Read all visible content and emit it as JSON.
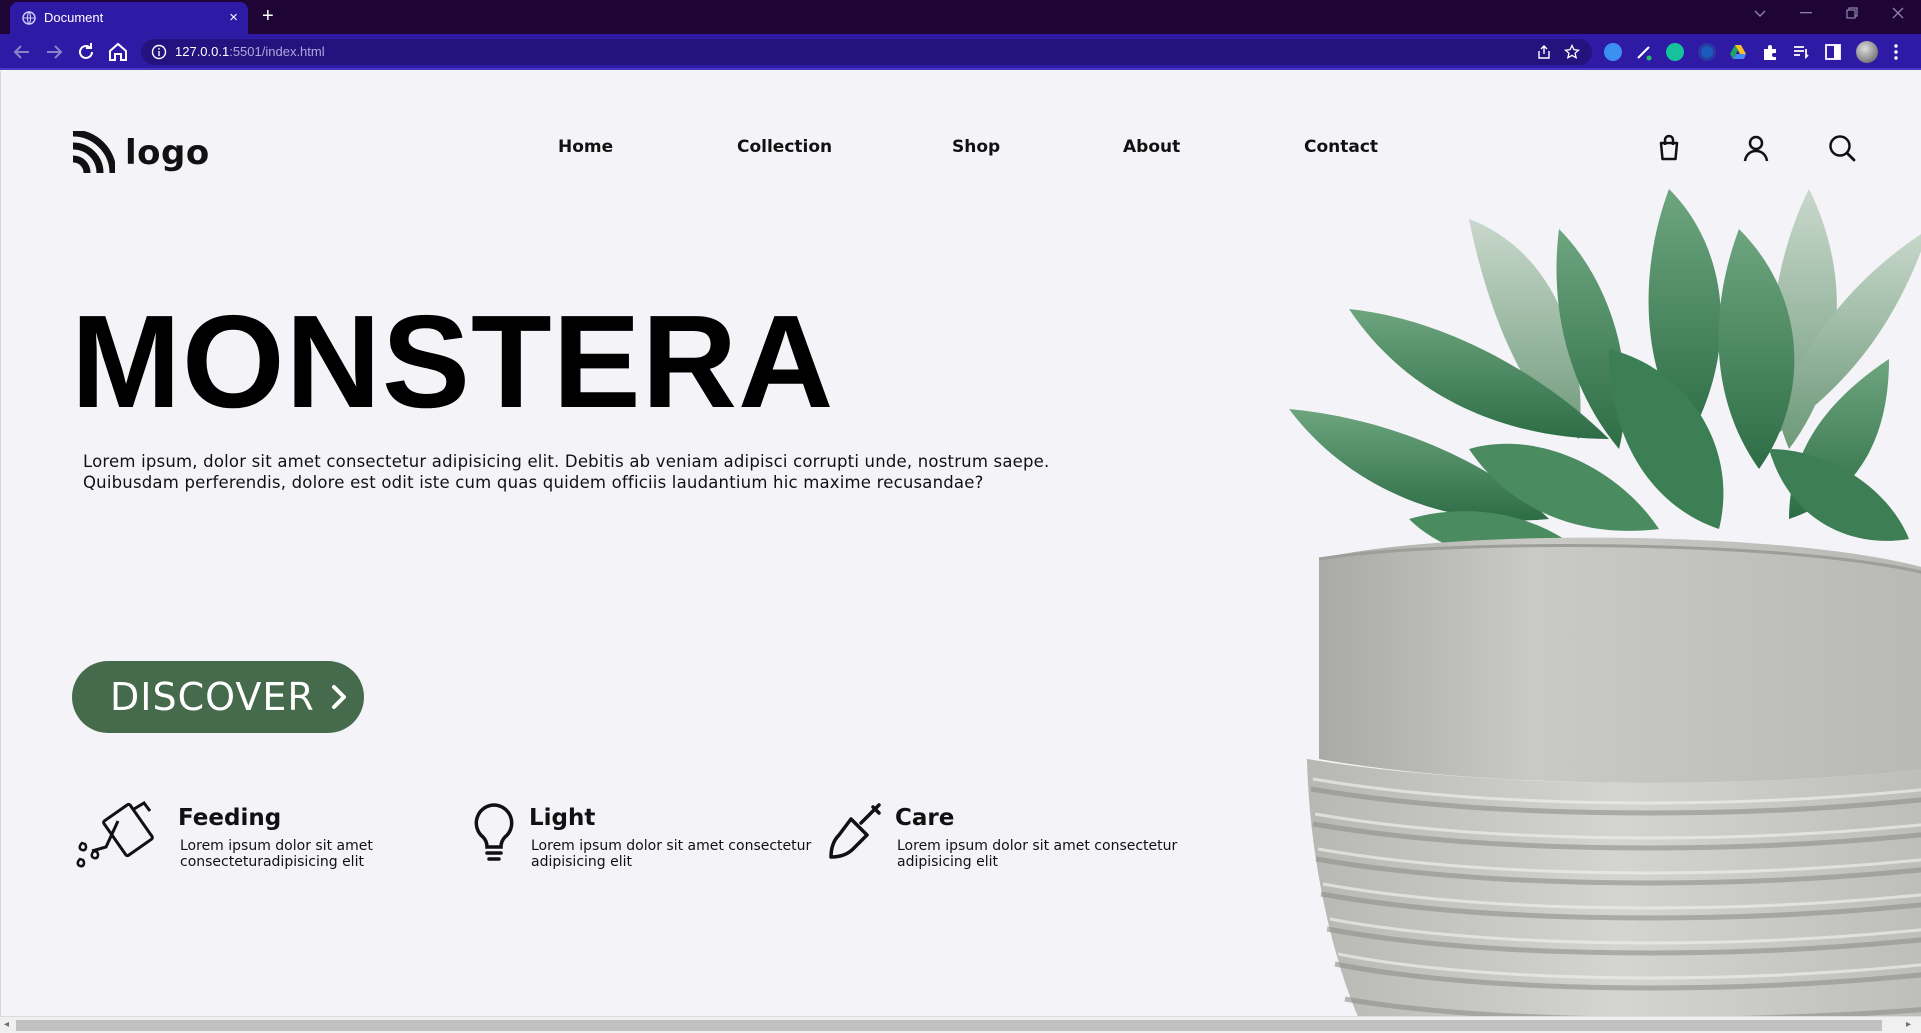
{
  "browser": {
    "tab_title": "Document",
    "tab_close": "×",
    "new_tab": "+",
    "url_host": "127.0.0.1",
    "url_rest": ":5501/index.html"
  },
  "header": {
    "logo_text": "logo",
    "nav": [
      "Home",
      "Collection",
      "Shop",
      "About",
      "Contact"
    ]
  },
  "hero": {
    "title": "MONSTERA",
    "description_line1": "Lorem ipsum, dolor sit amet consectetur adipisicing elit. Debitis ab veniam adipisci corrupti unde, nostrum saepe.",
    "description_line2": "Quibusdam perferendis, dolore est odit iste cum quas quidem officiis laudantium hic maxime recusandae?",
    "button_label": "DISCOVER"
  },
  "features": [
    {
      "icon": "watering-can-icon",
      "title": "Feeding",
      "line1": "Lorem ipsum dolor sit amet",
      "line2": "consecteturadipisicing elit"
    },
    {
      "icon": "lightbulb-icon",
      "title": "Light",
      "line1": "Lorem ipsum dolor sit amet consectetur",
      "line2": "adipisicing elit"
    },
    {
      "icon": "shovel-icon",
      "title": "Care",
      "line1": "Lorem ipsum dolor sit amet consectetur",
      "line2": "adipisicing elit"
    }
  ],
  "colors": {
    "accent_green": "#466b4c",
    "browser_purple": "#2f1aa6",
    "page_bg": "#f4f3f8"
  }
}
